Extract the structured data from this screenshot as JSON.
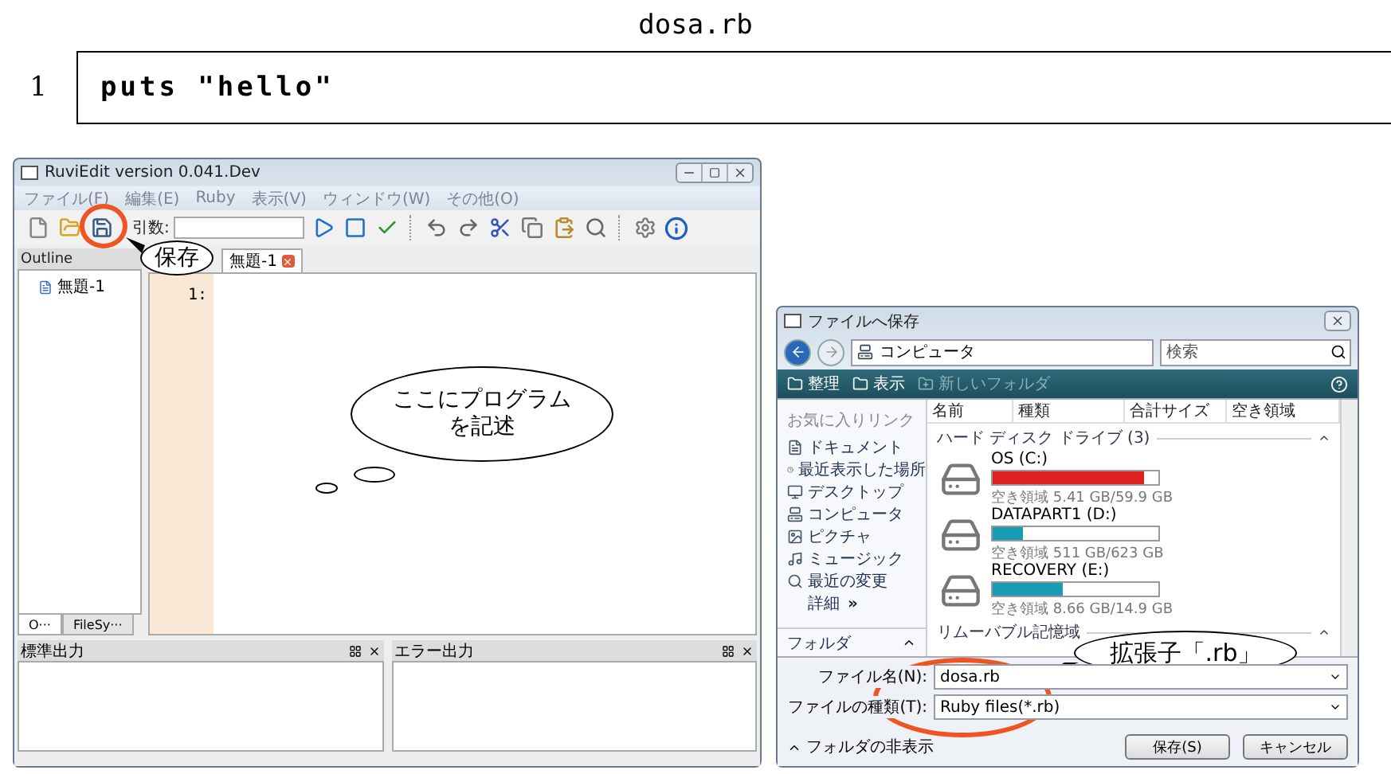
{
  "listing": {
    "title": "dosa.rb",
    "lines": [
      {
        "number": "1",
        "code": "puts \"hello\""
      }
    ]
  },
  "editor_window": {
    "title": "RuviEdit version 0.041.Dev",
    "menu": [
      "ファイル(F)",
      "編集(E)",
      "Ruby",
      "表示(V)",
      "ウィンドウ(W)",
      "その他(O)"
    ],
    "args_label": "引数:",
    "outline": {
      "title": "Outline",
      "items": [
        {
          "label": "無題-1"
        }
      ],
      "tabs": [
        {
          "label": "O···",
          "selected": true
        },
        {
          "label": "FileSy···",
          "selected": false
        }
      ]
    },
    "tabs": [
      {
        "label": "無題-1",
        "selected": true
      }
    ],
    "lines": [
      {
        "number": "1:"
      }
    ],
    "panels": [
      {
        "title": "標準出力"
      },
      {
        "title": "エラー出力"
      }
    ]
  },
  "save_dialog": {
    "title": "ファイルへ保存",
    "path": [
      "コンピュータ"
    ],
    "search": {
      "placeholder": "検索"
    },
    "toolbar": [
      {
        "label": "整理",
        "disabled": false
      },
      {
        "label": "表示",
        "disabled": false
      },
      {
        "label": "新しいフォルダ",
        "disabled": true
      }
    ],
    "favorites_title": "お気に入りリンク",
    "links": [
      {
        "kind": "doc",
        "label": "ドキュメント"
      },
      {
        "kind": "recent",
        "label": "最近表示した場所"
      },
      {
        "kind": "desktop",
        "label": "デスクトップ"
      },
      {
        "kind": "computer",
        "label": "コンピュータ"
      },
      {
        "kind": "picture",
        "label": "ピクチャ"
      },
      {
        "kind": "music",
        "label": "ミュージック"
      },
      {
        "kind": "search",
        "label": "最近の変更"
      }
    ],
    "more": "詳細",
    "more_arrow": "»",
    "folders_label": "フォルダ",
    "columns": [
      "名前",
      "種類",
      "合計サイズ",
      "空き領域"
    ],
    "groups": [
      {
        "title": "ハード ディスク ドライブ (3)",
        "drives": [
          {
            "name": "OS (C:)",
            "level": 0.91,
            "color": "#e02020",
            "free": "空き領域 5.41 GB/59.9 GB"
          },
          {
            "name": "DATAPART1 (D:)",
            "level": 0.18,
            "color": "#1a9bb5",
            "free": "空き領域 511 GB/623 GB"
          },
          {
            "name": "RECOVERY (E:)",
            "level": 0.42,
            "color": "#1a9bb5",
            "free": "空き領域 8.66 GB/14.9 GB"
          }
        ]
      },
      {
        "title": "リムーバブル記憶域"
      }
    ],
    "filename": {
      "label": "ファイル名(N):",
      "value": "dosa.rb"
    },
    "filetype": {
      "label": "ファイルの種類(T):",
      "value": "Ruby files(*.rb)"
    },
    "hide_folders": "フォルダの非表示",
    "buttons": [
      "保存(S)",
      "キャンセル"
    ]
  },
  "callouts": [
    {
      "kind": "speech",
      "lines": [
        "保存"
      ]
    },
    {
      "kind": "thought",
      "lines": [
        "ここにプログラム",
        "を記述"
      ]
    },
    {
      "kind": "speech",
      "lines": [
        "拡張子「.rb」"
      ]
    }
  ]
}
